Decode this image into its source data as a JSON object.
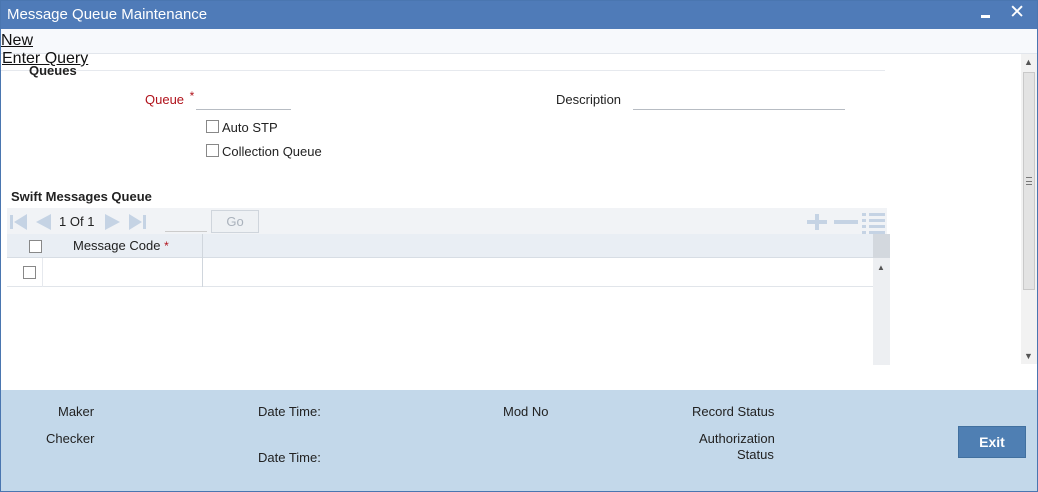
{
  "window": {
    "title": "Message Queue Maintenance",
    "minimize_icon": "minimize-icon",
    "close_label": "✕"
  },
  "menu": {
    "new_label": "New",
    "enter_query_label": "Enter Query"
  },
  "form": {
    "section_title": "Queues",
    "queue_label": "Queue",
    "queue_required": "*",
    "queue_value": "",
    "description_label": "Description",
    "description_value": "",
    "auto_stp_label": "Auto STP",
    "auto_stp_checked": false,
    "collection_queue_label": "Collection Queue",
    "collection_queue_checked": false
  },
  "swift_grid": {
    "title": "Swift Messages Queue",
    "page_current": "1",
    "page_of": "Of",
    "page_total": "1",
    "page_input_value": "",
    "go_label": "Go",
    "columns": [
      {
        "label": "Message Code",
        "required": "*"
      }
    ],
    "rows": [
      {
        "message_code": ""
      }
    ]
  },
  "footer": {
    "maker_label": "Maker",
    "checker_label": "Checker",
    "date_time_label_1": "Date Time:",
    "date_time_label_2": "Date Time:",
    "mod_no_label": "Mod No",
    "record_status_label": "Record Status",
    "authorization_label": "Authorization",
    "status_label": "Status",
    "exit_label": "Exit"
  },
  "colors": {
    "titlebar": "#4f7bb8",
    "footer": "#c3d8ea",
    "required": "#b0121b",
    "exit_button": "#4f7fb3"
  }
}
